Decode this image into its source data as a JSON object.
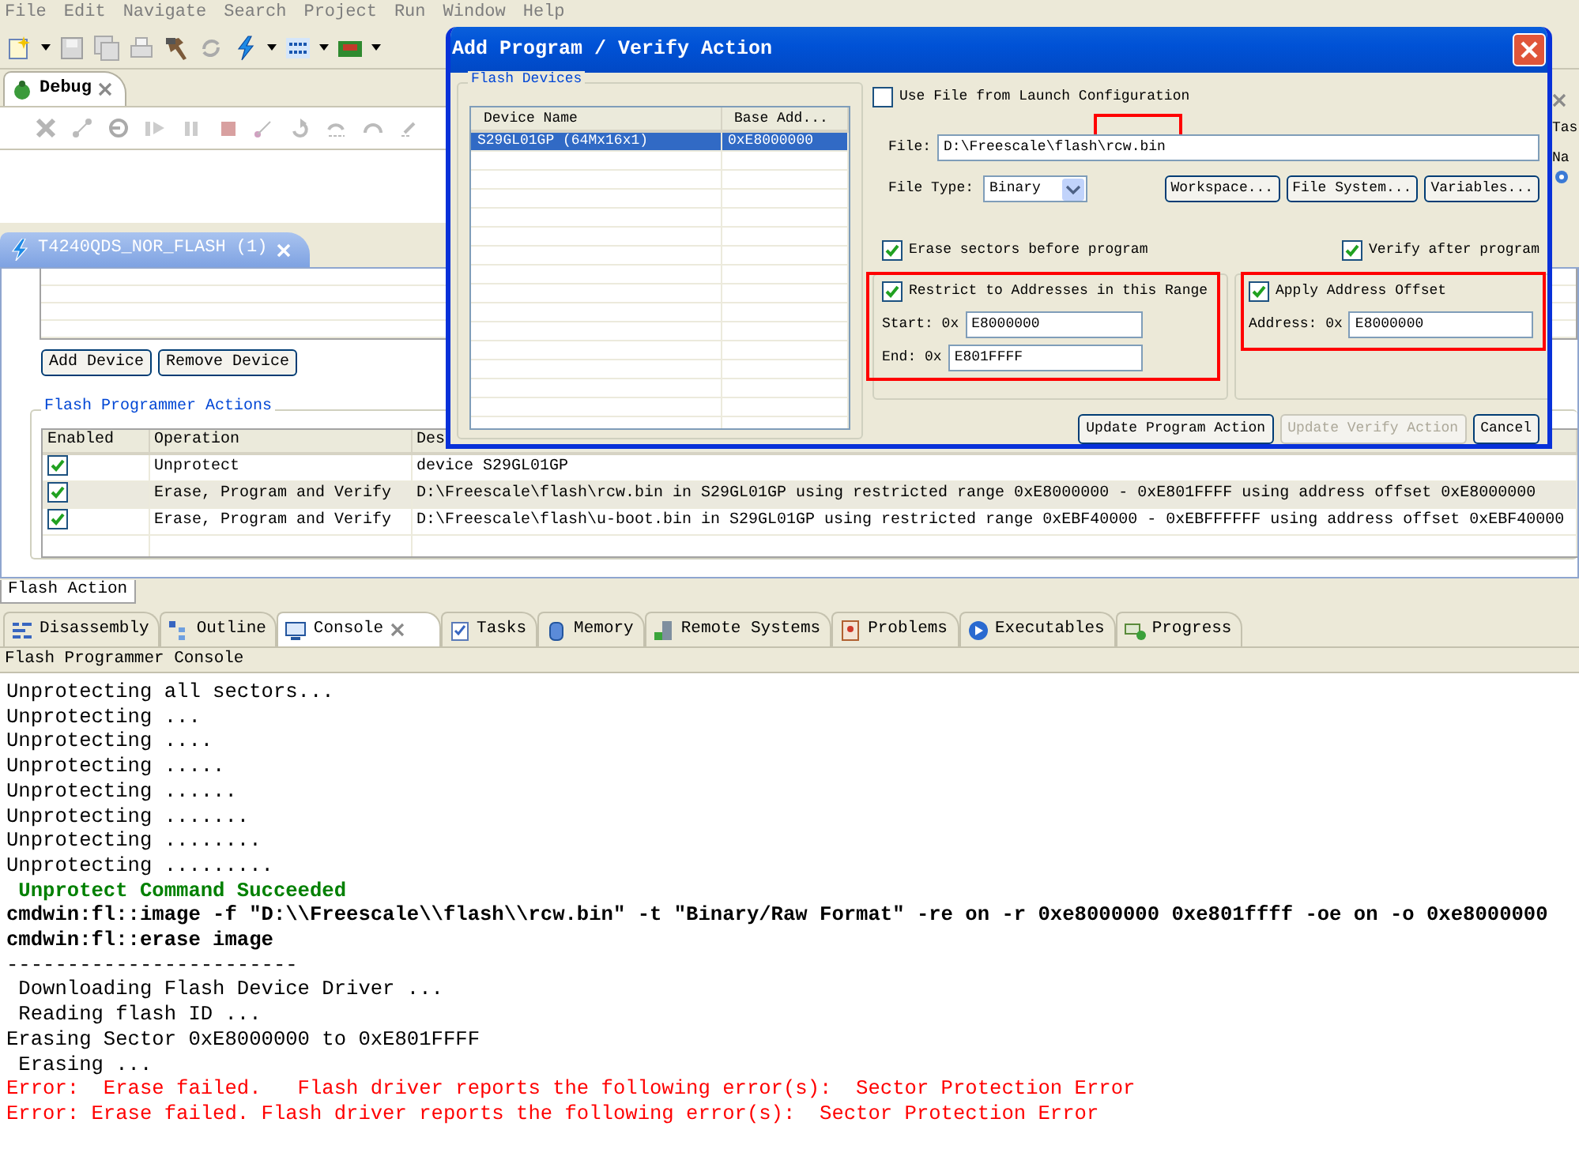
{
  "menu_bar": [
    "File",
    "Edit",
    "Navigate",
    "Search",
    "Project",
    "Run",
    "Window",
    "Help"
  ],
  "debug_view": {
    "tab": "Debug"
  },
  "side_view": {
    "tab": "Tas",
    "column": "Na"
  },
  "editor": {
    "tab": "T4240QDS_NOR_FLASH (1)",
    "device_buttons": [
      "Add Device",
      "Remove Device"
    ],
    "actions_group": "Flash Programmer Actions",
    "columns": [
      "Enabled",
      "Operation",
      "Des"
    ],
    "rows": [
      {
        "enabled": true,
        "selected": false,
        "operation": "Unprotect",
        "description": "device S29GL01GP"
      },
      {
        "enabled": true,
        "selected": true,
        "operation": "Erase, Program and Verify",
        "description": "D:\\Freescale\\flash\\rcw.bin in S29GL01GP using restricted range 0xE8000000 - 0xE801FFFF using address offset 0xE8000000"
      },
      {
        "enabled": true,
        "selected": false,
        "operation": "Erase, Program and Verify",
        "description": "D:\\Freescale\\flash\\u-boot.bin in S29GL01GP using restricted range 0xEBF40000 - 0xEBFFFFFF using address offset 0xEBF40000"
      }
    ],
    "bottom_tab": "Flash Action"
  },
  "bottom_tabs": [
    {
      "label": "Disassembly",
      "selected": false
    },
    {
      "label": "Outline",
      "selected": false
    },
    {
      "label": "Console",
      "selected": true
    },
    {
      "label": "Tasks",
      "selected": false
    },
    {
      "label": "Memory",
      "selected": false
    },
    {
      "label": "Remote Systems",
      "selected": false
    },
    {
      "label": "Problems",
      "selected": false
    },
    {
      "label": "Executables",
      "selected": false
    },
    {
      "label": "Progress",
      "selected": false
    }
  ],
  "console": {
    "title": "Flash Programmer Console",
    "lines": [
      {
        "kind": "plain",
        "text": "Unprotecting all sectors..."
      },
      {
        "kind": "plain",
        "text": "Unprotecting ..."
      },
      {
        "kind": "plain",
        "text": "Unprotecting ...."
      },
      {
        "kind": "plain",
        "text": "Unprotecting ....."
      },
      {
        "kind": "plain",
        "text": "Unprotecting ......"
      },
      {
        "kind": "plain",
        "text": "Unprotecting ......."
      },
      {
        "kind": "plain",
        "text": "Unprotecting ........"
      },
      {
        "kind": "plain",
        "text": "Unprotecting ........."
      },
      {
        "kind": "success",
        "text": " Unprotect Command Succeeded"
      },
      {
        "kind": "command",
        "text": "cmdwin:fl::image -f \"D:\\\\Freescale\\\\flash\\\\rcw.bin\" -t \"Binary/Raw Format\" -re on -r 0xe8000000 0xe801ffff -oe on -o 0xe8000000"
      },
      {
        "kind": "command",
        "text": "cmdwin:fl::erase image"
      },
      {
        "kind": "plain",
        "text": "------------------------"
      },
      {
        "kind": "plain",
        "text": " Downloading Flash Device Driver ..."
      },
      {
        "kind": "plain",
        "text": " Reading flash ID ..."
      },
      {
        "kind": "plain",
        "text": "Erasing Sector 0xE8000000 to 0xE801FFFF"
      },
      {
        "kind": "plain",
        "text": " Erasing ..."
      },
      {
        "kind": "error",
        "text": "Error:  Erase failed.   Flash driver reports the following error(s):  Sector Protection Error"
      },
      {
        "kind": "error",
        "text": "Error: Erase failed. Flash driver reports the following error(s):  Sector Protection Error"
      }
    ]
  },
  "dialog": {
    "title": "Add Program / Verify Action",
    "devices_group": "Flash Devices",
    "device_columns": [
      "Device Name",
      "Base Add..."
    ],
    "devices": [
      {
        "name": "S29GL01GP (64Mx16x1)",
        "base": "0xE8000000",
        "selected": true
      }
    ],
    "use_launch_file": {
      "label": "Use File from Launch Configuration",
      "checked": false
    },
    "file": {
      "label": "File:",
      "value": "D:\\Freescale\\flash\\rcw.bin"
    },
    "file_type": {
      "label": "File Type:",
      "value": "Binary"
    },
    "browse_buttons": [
      "Workspace...",
      "File System...",
      "Variables..."
    ],
    "erase": {
      "label": "Erase sectors before program",
      "checked": true
    },
    "verify": {
      "label": "Verify after program",
      "checked": true
    },
    "restrict": {
      "label": "Restrict to Addresses in this Range",
      "checked": true,
      "start_label": "Start: 0x",
      "start": "E8000000",
      "end_label": "End: 0x",
      "end": "E801FFFF"
    },
    "offset": {
      "label": "Apply Address Offset",
      "checked": true,
      "address_label": "Address: 0x",
      "address": "E8000000"
    },
    "buttons": [
      {
        "label": "Update Program Action",
        "disabled": false
      },
      {
        "label": "Update Verify Action",
        "disabled": true
      },
      {
        "label": "Cancel",
        "disabled": false
      }
    ]
  }
}
